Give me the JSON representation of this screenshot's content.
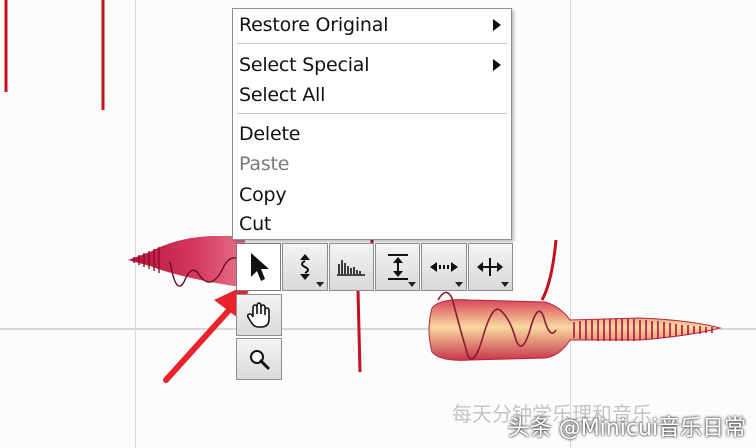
{
  "context_menu": {
    "items": [
      {
        "label": "Restore Original",
        "submenu": true,
        "enabled": true
      },
      {
        "label": "Select Special",
        "submenu": true,
        "enabled": true
      },
      {
        "label": "Select All",
        "submenu": false,
        "enabled": true
      },
      {
        "label": "Delete",
        "submenu": false,
        "enabled": true
      },
      {
        "label": "Paste",
        "submenu": false,
        "enabled": false
      },
      {
        "label": "Copy",
        "submenu": false,
        "enabled": true
      },
      {
        "label": "Cut",
        "submenu": false,
        "enabled": true
      }
    ]
  },
  "toolbar": {
    "tools": [
      {
        "icon": "arrow-pointer-icon",
        "active": true
      },
      {
        "icon": "pitch-tool-icon",
        "active": false
      },
      {
        "icon": "formant-tool-icon",
        "active": false
      },
      {
        "icon": "amplitude-tool-icon",
        "active": false
      },
      {
        "icon": "time-tool-icon",
        "active": false
      },
      {
        "icon": "move-tool-icon",
        "active": false
      }
    ],
    "subtools": [
      {
        "icon": "hand-icon"
      },
      {
        "icon": "magnifier-icon"
      }
    ]
  },
  "watermark": {
    "text": "头条 @Minicui音乐日常",
    "faint_text": "每天分钟学乐理和音乐"
  },
  "colors": {
    "blob_dark": "#b5123a",
    "blob_mid": "#d63b5f",
    "blob_light": "#f4d59a",
    "pitch_line": "#c2121e",
    "annotation_arrow": "#e8232b"
  }
}
